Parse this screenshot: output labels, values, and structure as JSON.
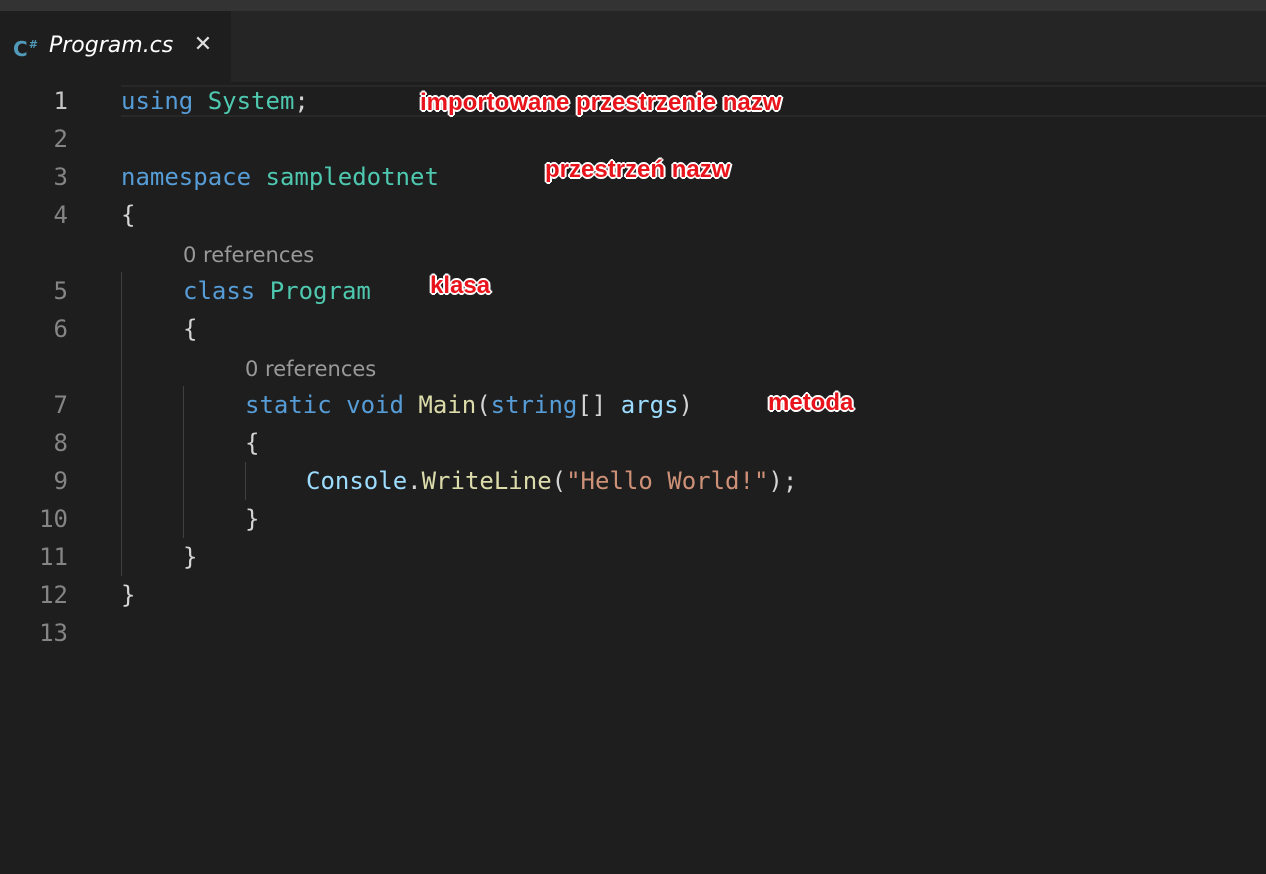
{
  "tab": {
    "icon": "C",
    "icon_suffix": "#",
    "icon_name": "csharp-file-icon",
    "title": "Program.cs",
    "close": "✕"
  },
  "editor": {
    "line_numbers": [
      "1",
      "2",
      "3",
      "4",
      "5",
      "6",
      "7",
      "8",
      "9",
      "10",
      "11",
      "12",
      "13"
    ],
    "active_line": 1,
    "codelens": [
      "0 references",
      "0 references"
    ],
    "lines": {
      "l1": {
        "kw": "using",
        "ns": "System",
        "end": ";"
      },
      "l3": {
        "kw": "namespace",
        "ns": "sampledotnet"
      },
      "l4": {
        "brace": "{"
      },
      "l5": {
        "kw": "class",
        "name": "Program"
      },
      "l6": {
        "brace": "{"
      },
      "l7": {
        "kw1": "static",
        "kw2": "void",
        "fn": "Main",
        "open": "(",
        "type": "string",
        "brackets": "[]",
        "param": "args",
        "close": ")"
      },
      "l8": {
        "brace": "{"
      },
      "l9": {
        "obj": "Console",
        "dot": ".",
        "fn": "WriteLine",
        "open": "(",
        "str": "\"Hello World!\"",
        "close": ");"
      },
      "l10": {
        "brace": "}"
      },
      "l11": {
        "brace": "}"
      },
      "l12": {
        "brace": "}"
      }
    }
  },
  "annotations": {
    "imports": "importowane przestrzenie nazw",
    "namespace": "przestrzeń nazw",
    "class": "klasa",
    "method": "metoda"
  },
  "colors": {
    "background": "#1e1e1e",
    "keyword": "#569cd6",
    "type": "#4ec9b0",
    "function": "#dcdcaa",
    "parameter": "#9cdcfe",
    "string": "#ce9178",
    "annotation": "#e8141b"
  }
}
